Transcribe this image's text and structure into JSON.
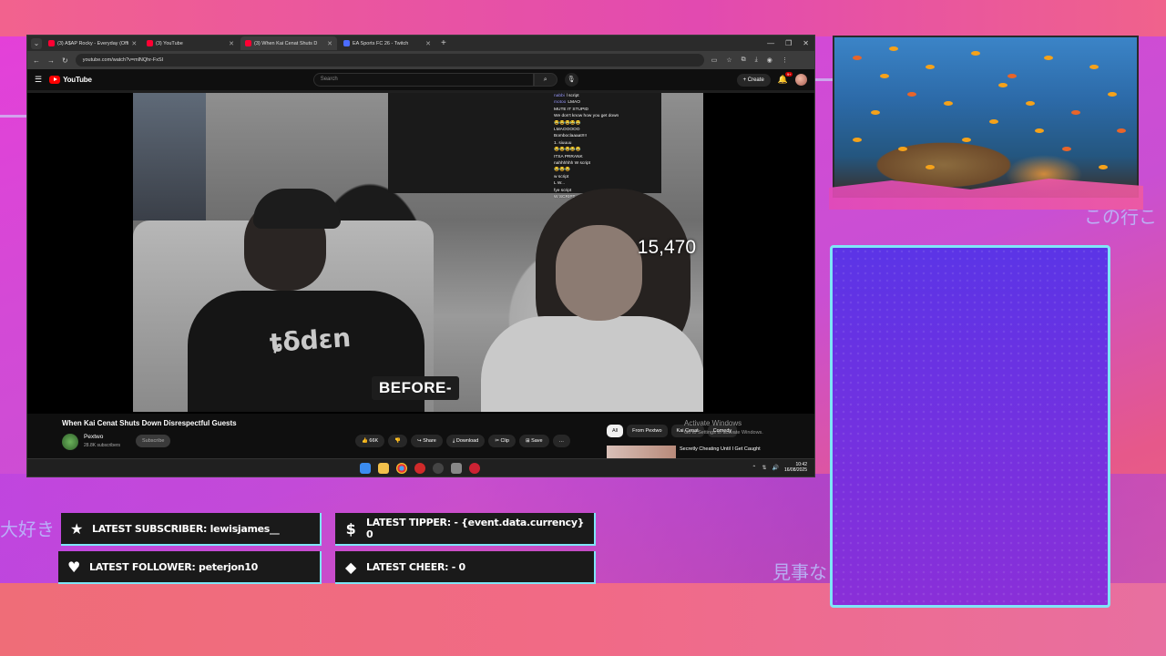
{
  "browser": {
    "tabs": [
      {
        "title": "(3) A$AP Rocky - Everyday (Offi",
        "active": false
      },
      {
        "title": "(3) YouTube",
        "active": false
      },
      {
        "title": "(3) When Kai Cenat Shuts D",
        "active": true
      },
      {
        "title": "EA Sports FC 26 - Twitch",
        "active": false
      }
    ],
    "url": "youtube.com/watch?v=mlNQhr-FxSI"
  },
  "youtube": {
    "logo_text": "YouTube",
    "search_placeholder": "Search",
    "create_label": "Create",
    "notification_count": "9+",
    "video": {
      "viewer_count": "15,470",
      "caption": "BEFORE-",
      "chat": [
        {
          "user": "nabbi",
          "text": "l script"
        },
        {
          "user": "motoo",
          "text": "LMAO"
        },
        {
          "user": "",
          "text": "MUTE IT STUPID"
        },
        {
          "user": "",
          "text": "We don't know how you get down"
        },
        {
          "user": "",
          "text": "😂😂😂😂😂"
        },
        {
          "user": "",
          "text": "LMAOOOOO"
        },
        {
          "user": "",
          "text": "Bomboclaaaat!!!!"
        },
        {
          "user": "",
          "text": "1. siuuuu"
        },
        {
          "user": "",
          "text": "😂😂😂😂😂"
        },
        {
          "user": "",
          "text": "ITSA PRRANK"
        },
        {
          "user": "",
          "text": "nahhhhhh W script"
        },
        {
          "user": "",
          "text": "😂😂😂"
        },
        {
          "user": "",
          "text": "w script"
        },
        {
          "user": "",
          "text": "L W..."
        },
        {
          "user": "",
          "text": "fye script"
        },
        {
          "user": "",
          "text": "W SCRIPT"
        }
      ]
    },
    "title": "When Kai Cenat Shuts Down Disrespectful Guests",
    "channel": {
      "name": "Pextwo",
      "subscribers": "28.8K subscribers",
      "subscribe_label": "Subscribe"
    },
    "actions": [
      {
        "icon": "thumbs-up-icon",
        "label": "66K"
      },
      {
        "icon": "thumbs-down-icon",
        "label": ""
      },
      {
        "icon": "share-icon",
        "label": "Share"
      },
      {
        "icon": "download-icon",
        "label": "Download"
      },
      {
        "icon": "clip-icon",
        "label": "Clip"
      },
      {
        "icon": "save-icon",
        "label": "Save"
      },
      {
        "icon": "more-icon",
        "label": "…"
      }
    ],
    "chips": [
      "All",
      "From Pextwo",
      "Kai Cenat",
      "Comedy"
    ],
    "recommendation_title": "Secretly Cheating Until I Get Caught",
    "activate_windows": {
      "title": "Activate Windows",
      "subtitle": "Go to Settings to activate Windows."
    }
  },
  "taskbar": {
    "time": "10:42",
    "date": "16/08/2025"
  },
  "overlay": {
    "latest_subscriber": "LATEST SUBSCRIBER: lewisjames__",
    "latest_tipper": "LATEST TIPPER:  - {event.data.currency} 0",
    "latest_follower": "LATEST FOLLOWER: peterjon10",
    "latest_cheer": "LATEST CHEER:  - 0",
    "jp_text_left": "大好き",
    "jp_text_right_top": "この行こ",
    "jp_text_right_mid": "見事な"
  },
  "colors": {
    "accent_cyan": "#7fe6f7",
    "bg_magenta": "#d34ad6",
    "panel_purple": "#6a33e2"
  }
}
